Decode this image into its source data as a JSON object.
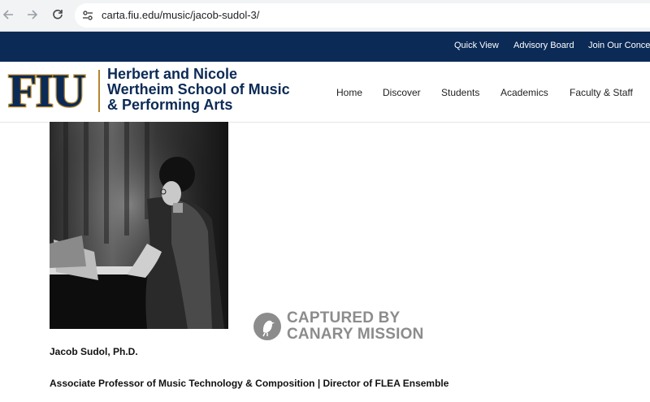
{
  "browser": {
    "url": "carta.fiu.edu/music/jacob-sudol-3/",
    "icons": {
      "back": "arrow-left-icon",
      "forward": "arrow-right-icon",
      "reload": "reload-icon",
      "site_info": "tune-icon"
    }
  },
  "topbar": {
    "links": [
      "Quick View",
      "Advisory Board",
      "Join Our Concert"
    ]
  },
  "header": {
    "logo_text": "FIU",
    "school_name": [
      "Herbert and Nicole",
      "Wertheim School of Music",
      "& Performing Arts"
    ],
    "nav": [
      "Home",
      "Discover",
      "Students",
      "Academics",
      "Faculty & Staff"
    ]
  },
  "profile": {
    "name": "Jacob Sudol, Ph.D.",
    "title": "Associate Professor of Music Technology & Composition | Director of FLEA Ensemble"
  },
  "watermark": {
    "lines": [
      "CAPTURED BY",
      "CANARY MISSION"
    ]
  },
  "colors": {
    "brand_navy": "#0b2a56",
    "brand_gold": "#b6862c",
    "watermark_gray": "#8c8c8c"
  }
}
